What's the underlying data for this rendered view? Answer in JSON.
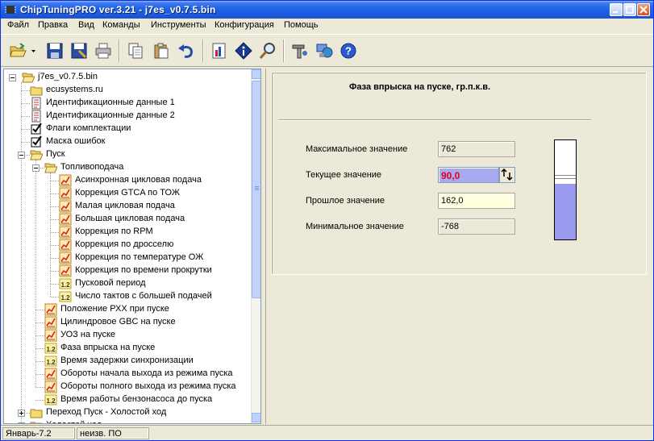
{
  "window": {
    "title": "ChipTuningPRO ver.3.21 - j7es_v0.7.5.bin"
  },
  "menu": [
    "Файл",
    "Правка",
    "Вид",
    "Команды",
    "Инструменты",
    "Конфигурация",
    "Помощь"
  ],
  "toolbar_icons": [
    "open-folder-icon",
    "save-icon",
    "save-as-icon",
    "print-icon",
    "copy-icon",
    "paste-icon",
    "undo-icon",
    "chart-icon",
    "info-icon",
    "search-icon",
    "tools-icon",
    "network-icon",
    "help-icon"
  ],
  "tree": {
    "root": "j7es_v0.7.5.bin",
    "items": [
      {
        "label": "ecusystems.ru",
        "icon": "folder-icon"
      },
      {
        "label": "Идентификационные данные 1",
        "icon": "document-icon"
      },
      {
        "label": "Идентификационные данные 2",
        "icon": "document-icon"
      },
      {
        "label": "Флаги комплектации",
        "icon": "checkbox-icon"
      },
      {
        "label": "Маска ошибок",
        "icon": "checkbox-icon"
      },
      {
        "label": "Пуск",
        "icon": "open-folder-icon"
      },
      {
        "label": "Топливоподача",
        "icon": "open-folder-icon"
      },
      {
        "label": "Асинхронная цикловая подача",
        "icon": "graph-icon"
      },
      {
        "label": "Коррекция GTCA по ТОЖ",
        "icon": "graph-icon"
      },
      {
        "label": "Малая цикловая подача",
        "icon": "graph-icon"
      },
      {
        "label": "Большая цикловая подача",
        "icon": "graph-icon"
      },
      {
        "label": "Коррекция по RPM",
        "icon": "graph-icon"
      },
      {
        "label": "Коррекция по дросселю",
        "icon": "graph-icon"
      },
      {
        "label": "Коррекция по температуре ОЖ",
        "icon": "graph-icon"
      },
      {
        "label": "Коррекция по времени прокрутки",
        "icon": "graph-icon"
      },
      {
        "label": "Пусковой период",
        "icon": "number-icon"
      },
      {
        "label": "Число тактов с большей подачей",
        "icon": "number-icon"
      },
      {
        "label": "Положение РХХ при пуске",
        "icon": "graph-icon"
      },
      {
        "label": "Цилиндровое GBC на пуске",
        "icon": "graph-icon"
      },
      {
        "label": "УОЗ на пуске",
        "icon": "graph-icon"
      },
      {
        "label": "Фаза впрыска на пуске",
        "icon": "number-icon"
      },
      {
        "label": "Время задержки синхронизации",
        "icon": "number-icon"
      },
      {
        "label": "Обороты начала выхода из режима пуска",
        "icon": "graph-icon"
      },
      {
        "label": "Обороты полного выхода из режима пуска",
        "icon": "graph-icon"
      },
      {
        "label": "Время работы бензонасоса до пуска",
        "icon": "number-icon"
      },
      {
        "label": "Переход Пуск - Холостой ход",
        "icon": "folder-icon"
      },
      {
        "label": "Холостой ход",
        "icon": "folder-icon"
      }
    ]
  },
  "param": {
    "title": "Фаза впрыска на пуске, гр.п.к.в.",
    "max_label": "Максимальное значение",
    "max_value": "762",
    "current_label": "Текущее значение",
    "current_value": "90,0",
    "past_label": "Прошлое значение",
    "past_value": "162,0",
    "min_label": "Минимальное значение",
    "min_value": "-768",
    "gauge_fraction": 0.56
  },
  "status": {
    "left": "Январь-7.2",
    "right": "неизв. ПО"
  }
}
